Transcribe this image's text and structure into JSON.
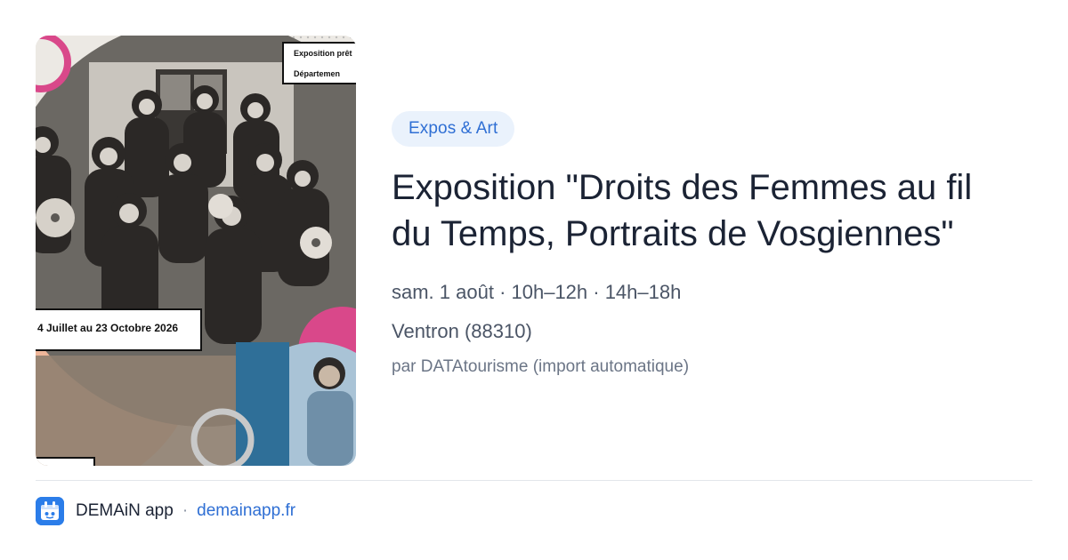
{
  "event": {
    "category": "Expos & Art",
    "title": "Exposition \"Droits des Femmes au fil du Temps, Portraits de Vosgiennes\"",
    "when": "sam. 1 août · 10h–12h · 14h–18h",
    "where": "Ventron (88310)",
    "source": "par DATAtourisme (import automatique)"
  },
  "poster": {
    "top_label_line1": "Exposition prêt",
    "top_label_line2": "Départemen",
    "date_label": "4 Juillet au 23 Octobre 2026"
  },
  "footer": {
    "app_name": "DEMAiN app",
    "separator": "·",
    "domain": "demainapp.fr"
  },
  "colors": {
    "accent": "#2f6fd4",
    "pill_bg": "#eaf2fc",
    "app_icon_bg": "#2b7de9",
    "poster_pink": "#d9488a"
  }
}
